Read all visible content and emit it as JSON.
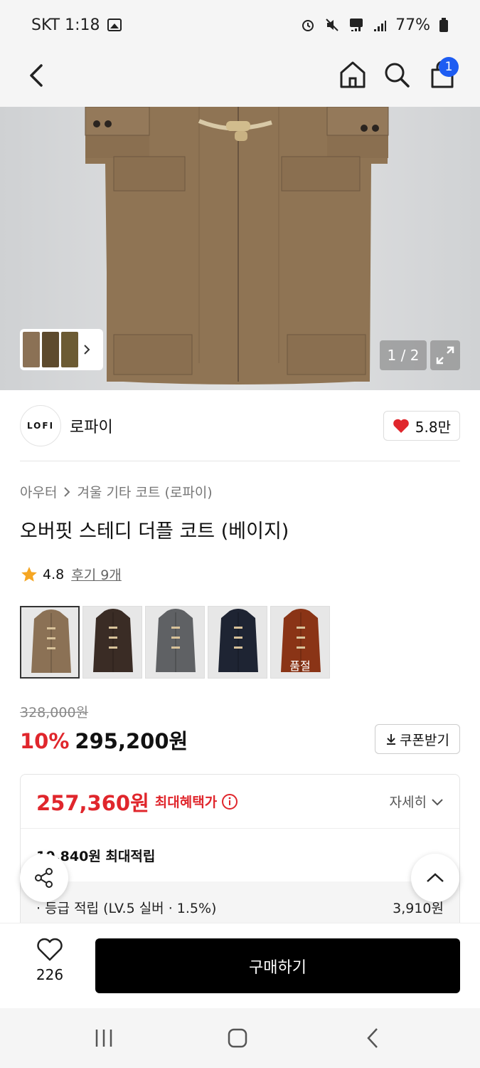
{
  "status_bar": {
    "carrier_time": "SKT 1:18",
    "battery": "77%"
  },
  "header": {
    "cart_count": "1"
  },
  "gallery": {
    "counter": "1 / 2"
  },
  "brand": {
    "logo_text": "LOFI",
    "name": "로파이",
    "likes": "5.8만"
  },
  "breadcrumb": {
    "level1": "아우터",
    "level2": "겨울 기타 코트 (로파이)"
  },
  "product": {
    "title": "오버핏 스테디 더플 코트 (베이지)",
    "rating": "4.8",
    "review_link": "후기 9개"
  },
  "variants": [
    {
      "color": "#8b7155",
      "sold_out": ""
    },
    {
      "color": "#3a2c25",
      "sold_out": ""
    },
    {
      "color": "#5f6164",
      "sold_out": ""
    },
    {
      "color": "#1e2433",
      "sold_out": ""
    },
    {
      "color": "#8a3416",
      "sold_out": "품절"
    }
  ],
  "pricing": {
    "original": "328,000원",
    "discount": "10%",
    "sale": "295,200원",
    "coupon_label": "쿠폰받기"
  },
  "benefit": {
    "max_price": "257,360원",
    "max_label": "최대혜택가",
    "detail_label": "자세히",
    "points": "10,840원 최대적립",
    "grade_label": "· 등급 적립 (LV.5 실버 · 1.5%)",
    "grade_amount": "3,910원"
  },
  "bottom": {
    "wish_count": "226",
    "buy_label": "구매하기"
  },
  "colors": {
    "accent_red": "#e0262c",
    "badge_blue": "#1d5cf2"
  }
}
